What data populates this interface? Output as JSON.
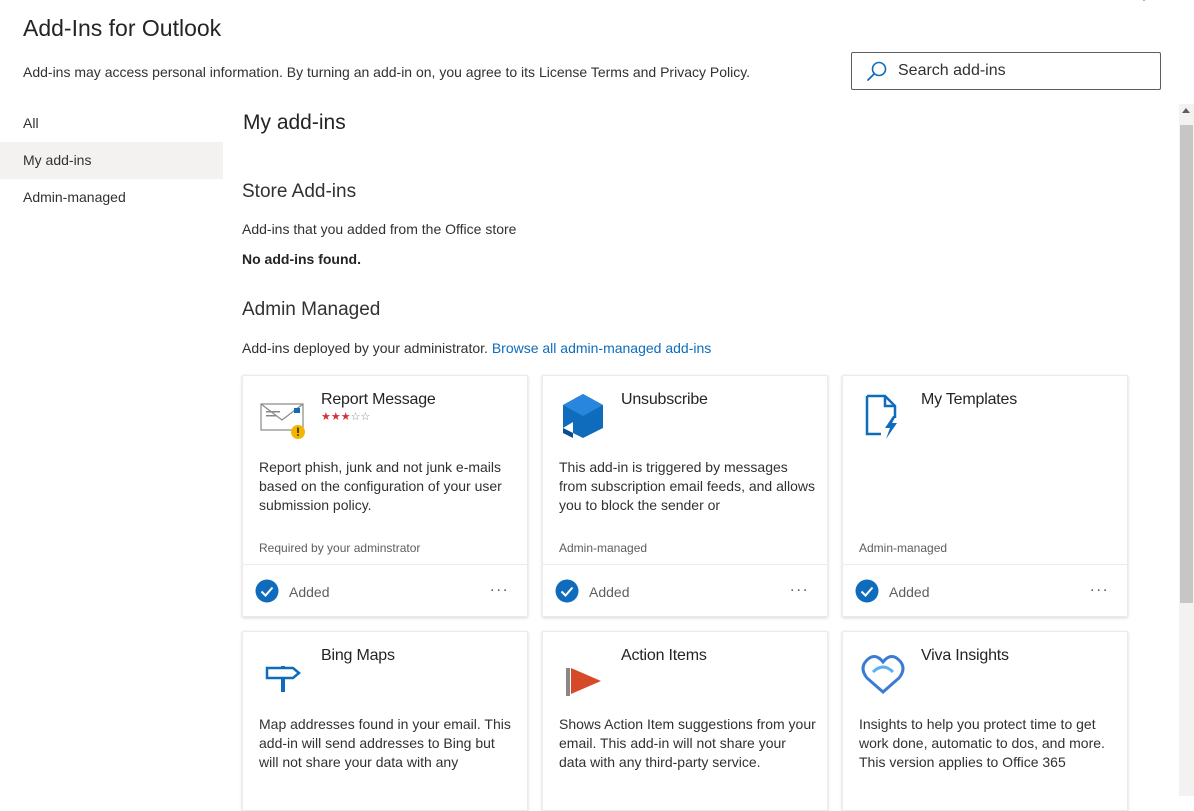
{
  "header": {
    "title": "Add-Ins for Outlook",
    "disclaimer": "Add-ins may access personal information. By turning an add-in on, you agree to its License Terms and Privacy Policy.",
    "search_placeholder": "Search add-ins"
  },
  "nav": {
    "items": [
      {
        "label": "All"
      },
      {
        "label": "My add-ins"
      },
      {
        "label": "Admin-managed"
      }
    ],
    "active": "My add-ins"
  },
  "main": {
    "title": "My add-ins",
    "store": {
      "title": "Store Add-ins",
      "desc": "Add-ins that you added from the Office store",
      "empty": "No add-ins found."
    },
    "admin": {
      "title": "Admin Managed",
      "desc": "Add-ins deployed by your administrator.",
      "link": "Browse all admin-managed add-ins"
    }
  },
  "cards": [
    {
      "name": "Report Message",
      "rating": 3,
      "rating_max": 5,
      "desc": "Report phish, junk and not junk e-mails based on the configuration of your user submission policy.",
      "meta": "Required by your adminstrator",
      "status": "Added",
      "more": "...",
      "icon": "envelope-warning-icon"
    },
    {
      "name": "Unsubscribe",
      "desc": "This add-in is triggered by messages from subscription email feeds, and allows you to block the sender or",
      "meta": "Admin-managed",
      "status": "Added",
      "more": "...",
      "icon": "blue-cube-icon"
    },
    {
      "name": "My Templates",
      "desc": "",
      "meta": "Admin-managed",
      "status": "Added",
      "more": "...",
      "icon": "document-lightning-icon"
    },
    {
      "name": "Bing Maps",
      "desc": "Map addresses found in your email. This add-in will send addresses to Bing but will not share your data with any",
      "icon": "signpost-icon"
    },
    {
      "name": "Action Items",
      "desc": "Shows Action Item suggestions from your email. This add-in will not share your data with any third-party service.",
      "icon": "flag-icon"
    },
    {
      "name": "Viva Insights",
      "desc": "Insights to help you protect time to get work done, automatic to dos, and more. This version applies to Office 365",
      "icon": "viva-insights-icon"
    }
  ],
  "colors": {
    "accent": "#0f6cbd",
    "check": "#0f6cbd",
    "star_on": "#d13438",
    "flag": "#d74a28"
  }
}
